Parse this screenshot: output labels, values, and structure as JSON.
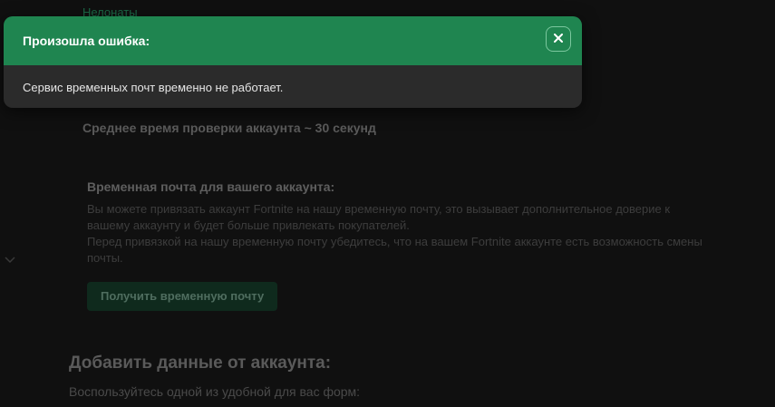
{
  "background": {
    "top_link": "Нелонаты",
    "avg_check_time": "Среднее время проверки аккаунта ~ 30 секунд",
    "temp_mail": {
      "heading": "Временная почта для вашего аккаунта:",
      "para1": "Вы можете привязать аккаунт Fortnite на нашу временную почту, это вызывает дополнительное доверие к вашему аккаунту и будет больше привлекать покупателей.",
      "para2": "Перед привязкой на нашу временную почту убедитесь, что на вашем Fortnite аккаунте есть возможность смены почты.",
      "button_label": "Получить временную почту"
    },
    "add_data_title": "Добавить данные от аккаунта:",
    "add_data_subtitle": "Воспользуйтесь одной из удобной для вас форм:"
  },
  "toast": {
    "title": "Произошла ошибка:",
    "message": "Сервис временных почт временно не работает.",
    "close_icon": "close-icon",
    "header_color": "#1f8550",
    "body_color": "#2b2b2b"
  }
}
